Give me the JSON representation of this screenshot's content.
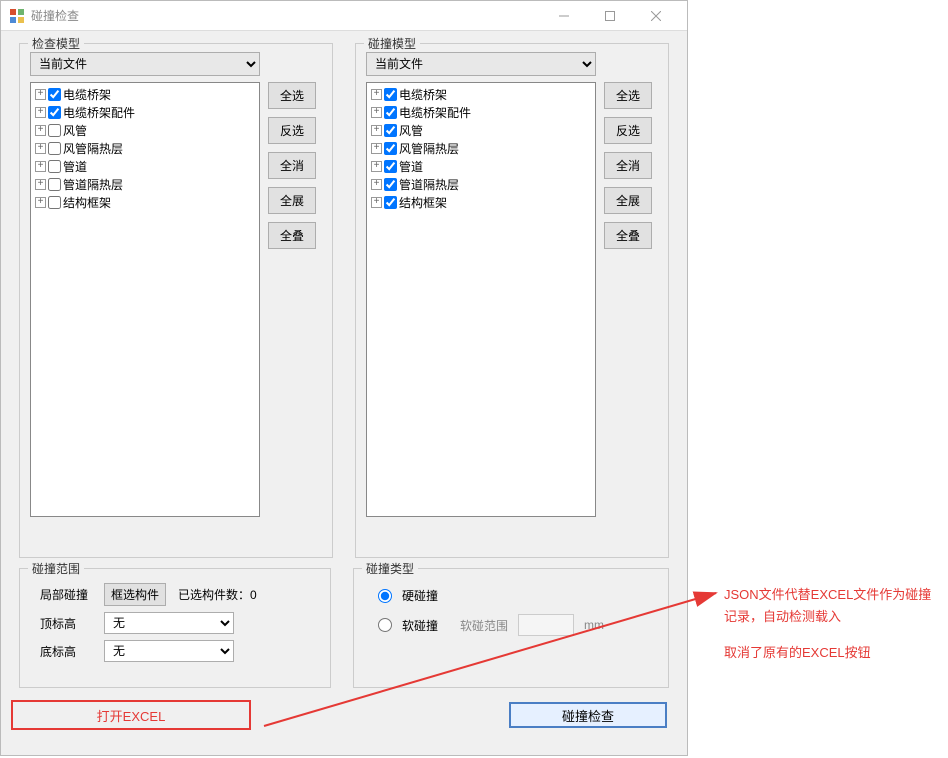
{
  "window": {
    "title": "碰撞检查"
  },
  "check_model": {
    "group_label": "检查模型",
    "dropdown": "当前文件",
    "items": [
      {
        "label": "电缆桥架",
        "checked": true
      },
      {
        "label": "电缆桥架配件",
        "checked": true
      },
      {
        "label": "风管",
        "checked": false
      },
      {
        "label": "风管隔热层",
        "checked": false
      },
      {
        "label": "管道",
        "checked": false
      },
      {
        "label": "管道隔热层",
        "checked": false
      },
      {
        "label": "结构框架",
        "checked": false
      }
    ],
    "buttons": {
      "select_all": "全选",
      "invert": "反选",
      "clear_all": "全消",
      "expand_all": "全展",
      "collapse_all": "全叠"
    }
  },
  "clash_model": {
    "group_label": "碰撞模型",
    "dropdown": "当前文件",
    "items": [
      {
        "label": "电缆桥架",
        "checked": true
      },
      {
        "label": "电缆桥架配件",
        "checked": true
      },
      {
        "label": "风管",
        "checked": true
      },
      {
        "label": "风管隔热层",
        "checked": true
      },
      {
        "label": "管道",
        "checked": true
      },
      {
        "label": "管道隔热层",
        "checked": true
      },
      {
        "label": "结构框架",
        "checked": true
      }
    ],
    "buttons": {
      "select_all": "全选",
      "invert": "反选",
      "clear_all": "全消",
      "expand_all": "全展",
      "collapse_all": "全叠"
    }
  },
  "range": {
    "group_label": "碰撞范围",
    "local_label": "局部碰撞",
    "pick_btn": "框选构件",
    "count_label": "已选构件数：0",
    "top_label": "顶标高",
    "top_value": "无",
    "bottom_label": "底标高",
    "bottom_value": "无"
  },
  "type": {
    "group_label": "碰撞类型",
    "hard_label": "硬碰撞",
    "soft_label": "软碰撞",
    "soft_range_label": "软碰范围",
    "soft_range_value": "",
    "unit": "mm"
  },
  "footer": {
    "open_excel": "打开EXCEL",
    "check": "碰撞检查"
  },
  "annotation": {
    "line1": "JSON文件代替EXCEL文件作为碰撞记录，自动检测载入",
    "line2": "取消了原有的EXCEL按钮"
  }
}
